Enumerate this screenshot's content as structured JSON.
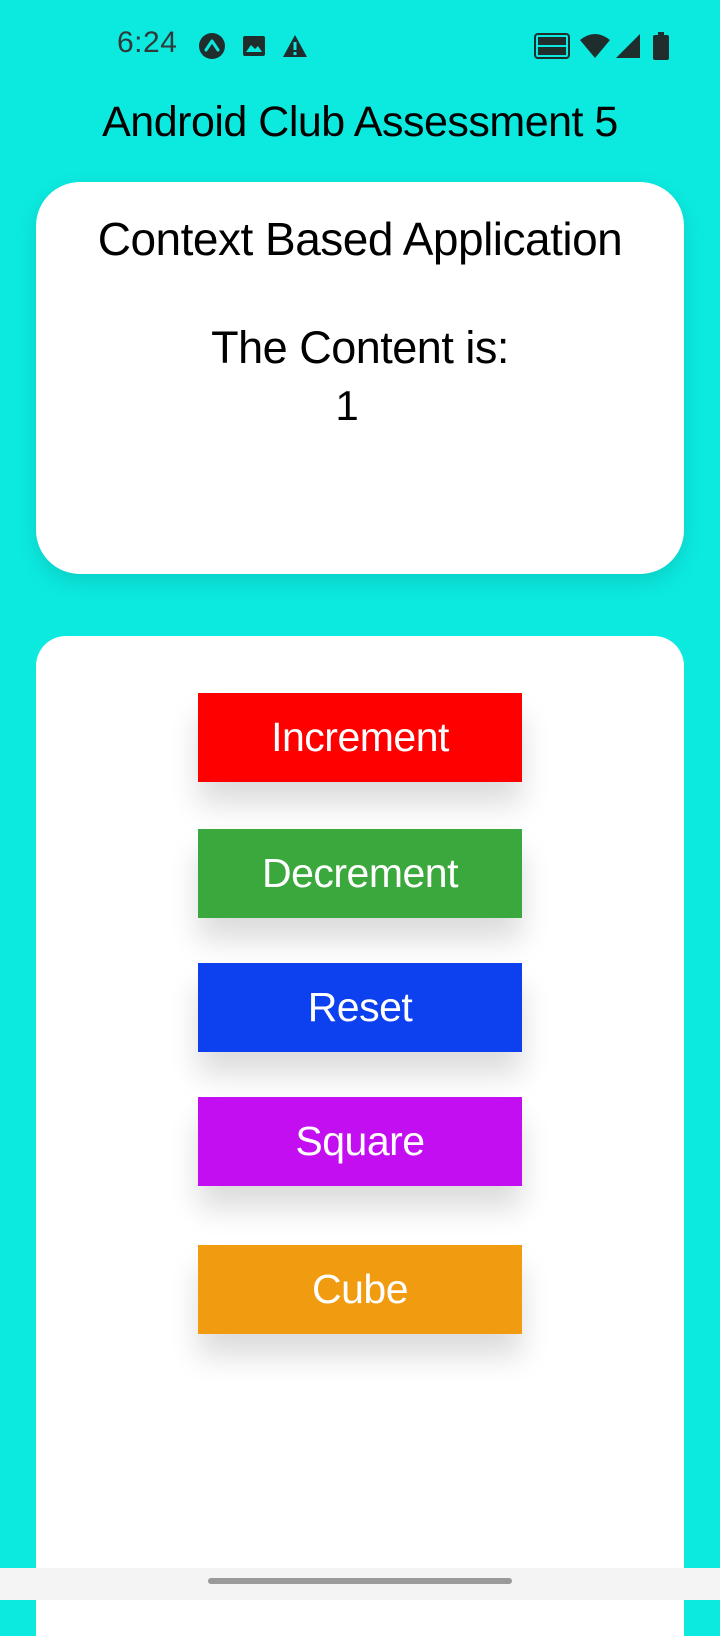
{
  "status_bar": {
    "time": "6:24",
    "icons": [
      "app-notification-icon",
      "image-icon",
      "warning-icon",
      "vowifi-icon",
      "wifi-icon",
      "signal-icon",
      "battery-icon"
    ]
  },
  "app": {
    "title": "Android Club Assessment 5",
    "background_color": "#0ceae0"
  },
  "content_card": {
    "title": "Context Based Application",
    "label": "The Content is:",
    "value": "1"
  },
  "buttons": [
    {
      "label": "Increment",
      "color": "#ff0000"
    },
    {
      "label": "Decrement",
      "color": "#3ba83d"
    },
    {
      "label": "Reset",
      "color": "#0d40ef"
    },
    {
      "label": "Square",
      "color": "#c20ef0"
    },
    {
      "label": "Cube",
      "color": "#f09b10"
    }
  ]
}
